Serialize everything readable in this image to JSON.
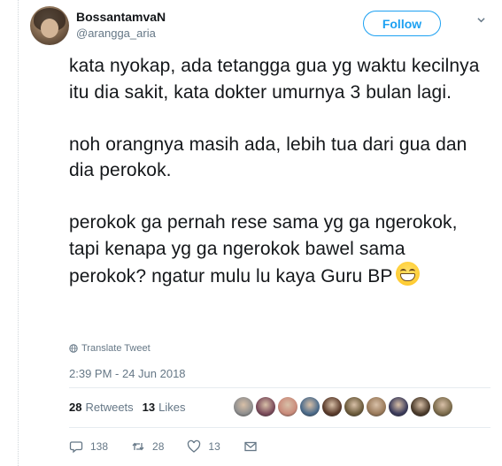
{
  "user": {
    "display_name": "BossantamvaN",
    "handle": "@arangga_aria"
  },
  "follow_button": {
    "label": "Follow"
  },
  "tweet": {
    "paragraphs": [
      "kata nyokap, ada tetangga gua yg waktu kecilnya itu dia sakit, kata dokter umurnya 3 bulan lagi.",
      "noh orangnya masih ada, lebih tua dari gua dan dia perokok.",
      "perokok ga pernah rese sama yg ga ngerokok, tapi kenapa yg ga ngerokok bawel sama perokok? ngatur mulu lu kaya Guru BP"
    ],
    "emoji": "grinning-face-icon",
    "translate_label": "Translate Tweet",
    "timestamp": "2:39 PM - 24 Jun 2018"
  },
  "stats": {
    "retweets_count": "28",
    "retweets_label": "Retweets",
    "likes_count": "13",
    "likes_label": "Likes"
  },
  "likers": [
    {
      "color": "#8e8e8e"
    },
    {
      "color": "#7a4a5a"
    },
    {
      "color": "#c98a7a"
    },
    {
      "color": "#4a6a8a"
    },
    {
      "color": "#5a3a2a"
    },
    {
      "color": "#6b5a3a"
    },
    {
      "color": "#9a7a5a"
    },
    {
      "color": "#3a3a5a"
    },
    {
      "color": "#4a3a2a"
    },
    {
      "color": "#7a6a4a"
    }
  ],
  "actions": {
    "reply_count": "138",
    "retweet_count": "28",
    "like_count": "13"
  },
  "colors": {
    "accent": "#1da1f2",
    "secondary_text": "#657786",
    "primary_text": "#14171a",
    "divider": "#e6ecf0"
  }
}
